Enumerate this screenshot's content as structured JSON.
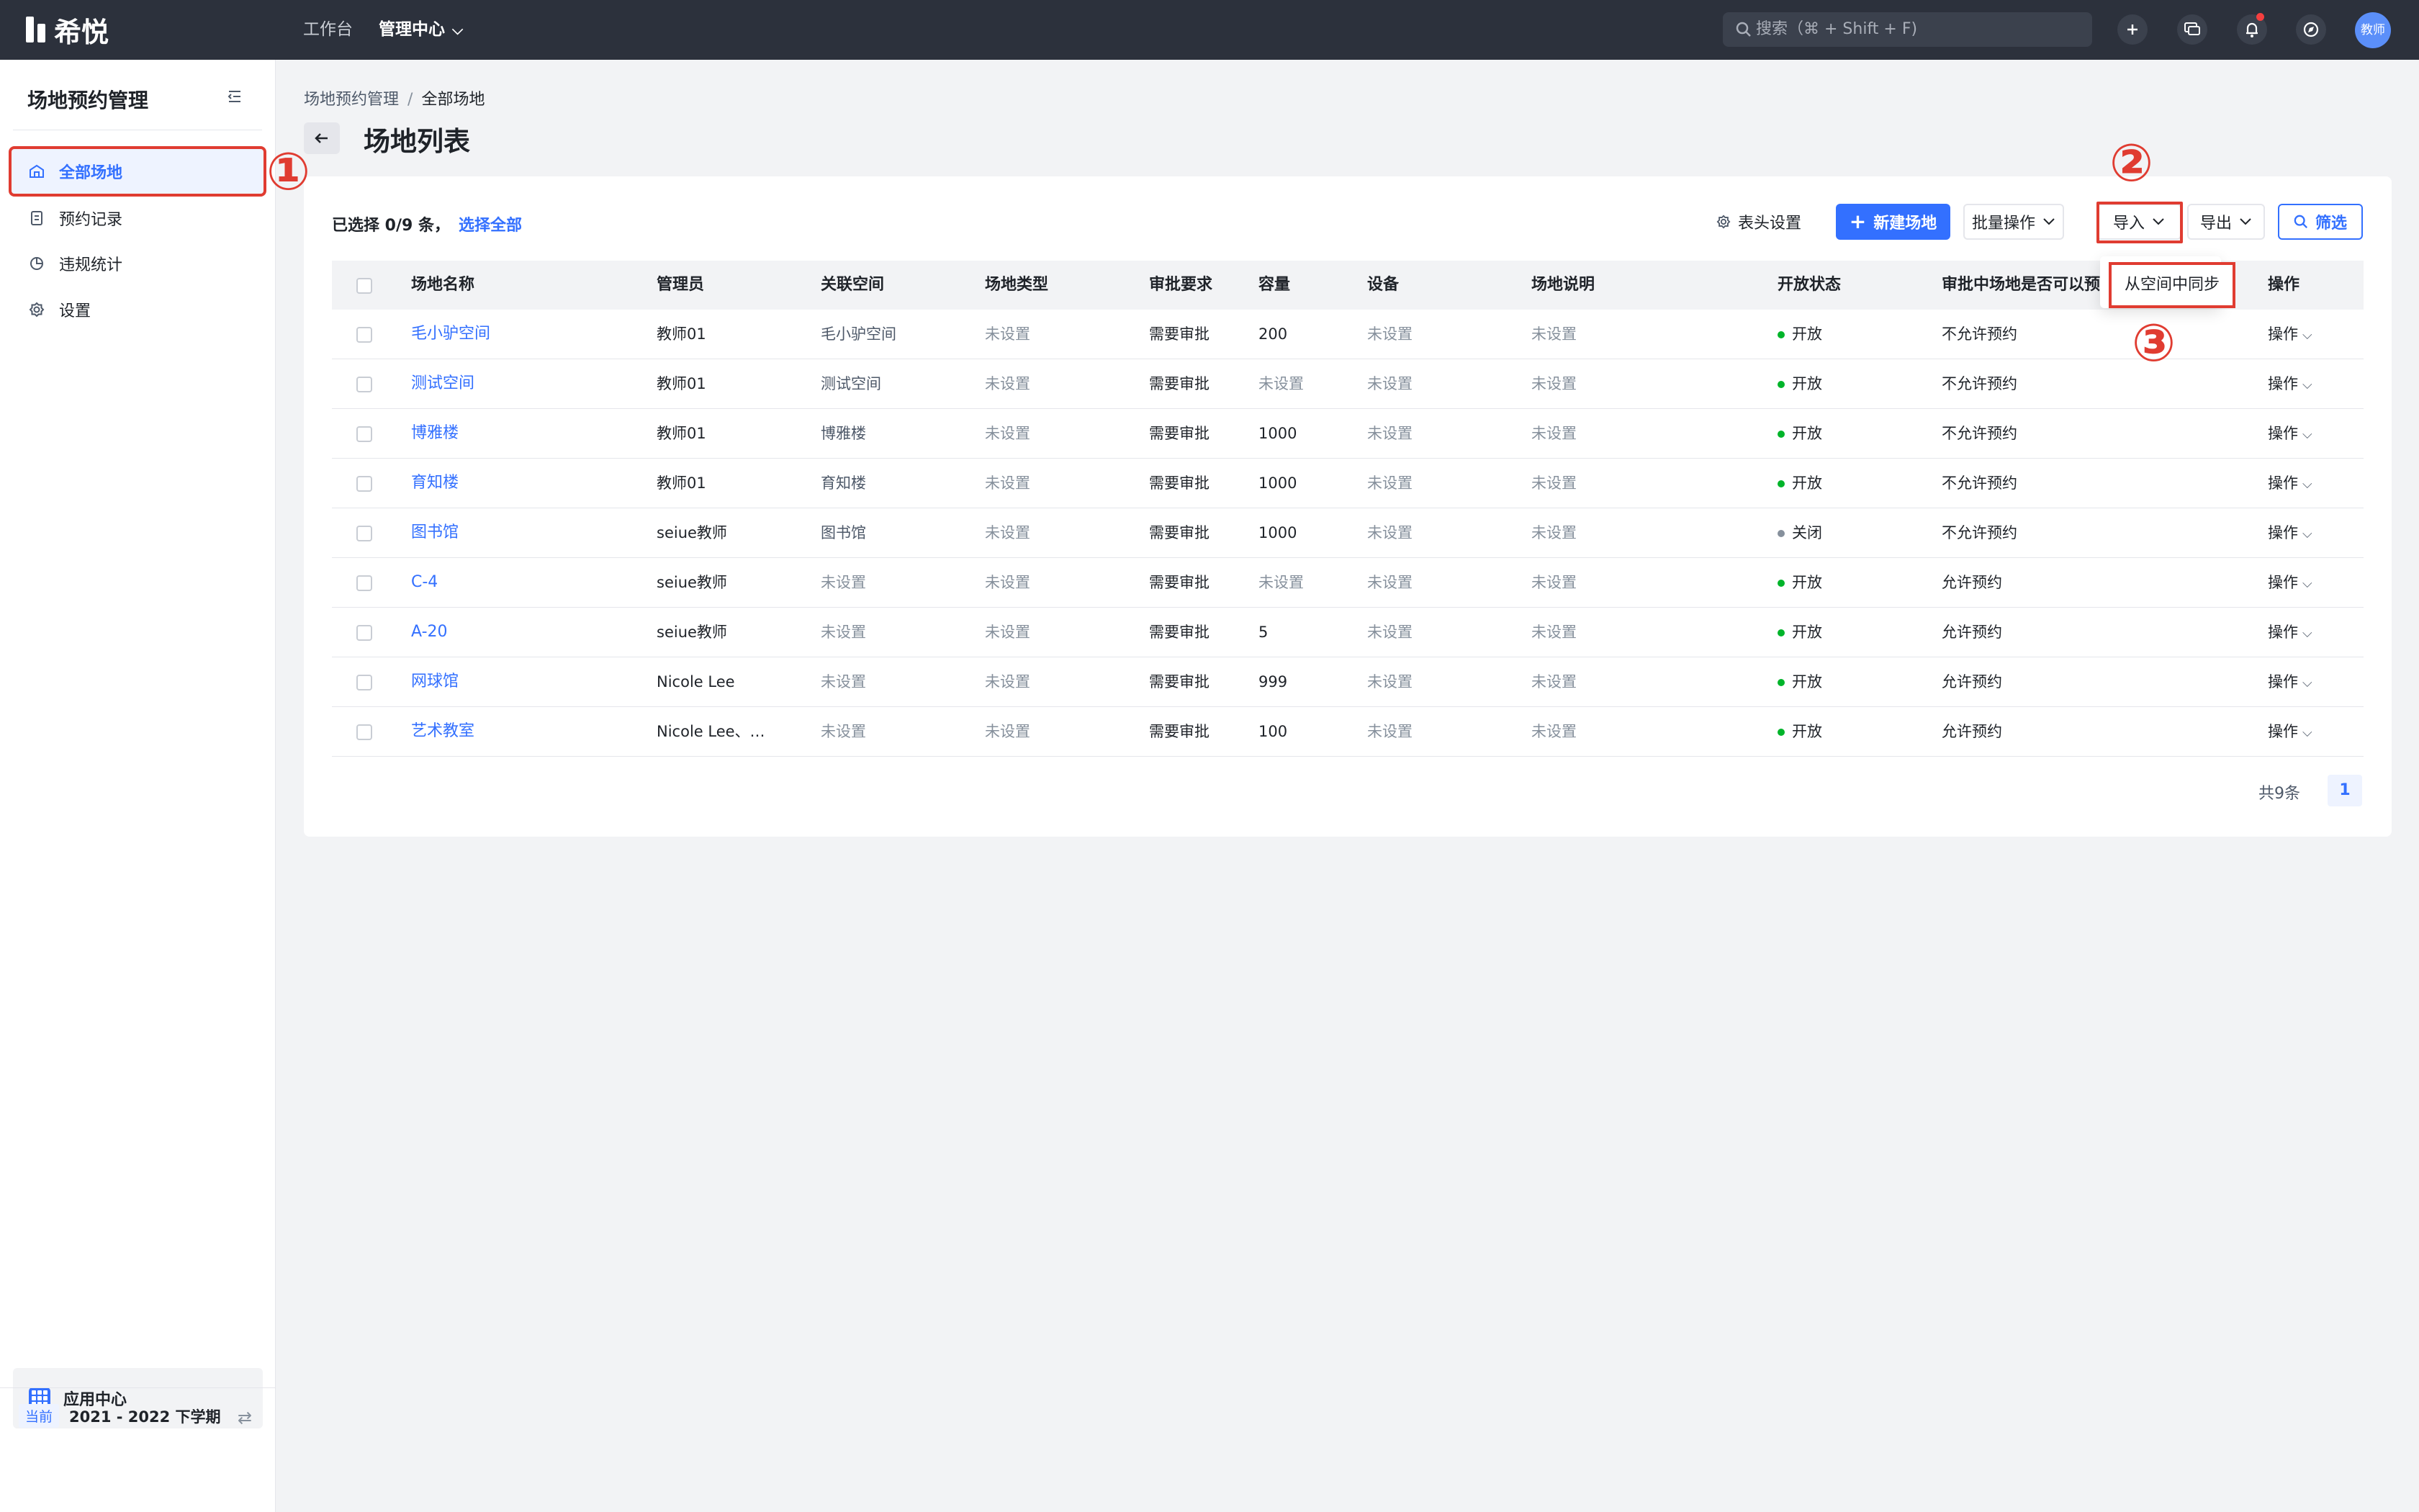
{
  "topbar": {
    "logo_text": "希悦",
    "nav": [
      {
        "label": "工作台"
      },
      {
        "label": "管理中心"
      }
    ],
    "search_placeholder": "搜索（⌘ + Shift + F)",
    "avatar_text": "教师"
  },
  "sidebar": {
    "title": "场地预约管理",
    "items": [
      {
        "label": "全部场地",
        "icon": "building-icon",
        "active": true
      },
      {
        "label": "预约记录",
        "icon": "document-icon",
        "active": false
      },
      {
        "label": "违规统计",
        "icon": "pie-chart-icon",
        "active": false
      },
      {
        "label": "设置",
        "icon": "gear-icon",
        "active": false
      }
    ],
    "app_center": "应用中心",
    "term_badge": "当前",
    "term": "2021 - 2022 下学期"
  },
  "main": {
    "breadcrumb": [
      "场地预约管理",
      "全部场地"
    ],
    "breadcrumb_sep": "/",
    "title": "场地列表",
    "selection_text": "已选择 0/9 条，",
    "select_all": "选择全部",
    "toolbar": {
      "column_settings": "表头设置",
      "new_venue": "新建场地",
      "batch": "批量操作",
      "import": "导入",
      "export": "导出",
      "filter": "筛选"
    },
    "import_menu": [
      "从空间中同步"
    ],
    "annotations": [
      "①",
      "②",
      "③"
    ],
    "columns": [
      "场地名称",
      "管理员",
      "关联空间",
      "场地类型",
      "审批要求",
      "容量",
      "设备",
      "场地说明",
      "开放状态",
      "审批中场地是否可以预约",
      "操作"
    ],
    "rows": [
      {
        "name": "毛小驴空间",
        "admin": "教师01",
        "space": "毛小驴空间",
        "type": "未设置",
        "approval": "需要审批",
        "capacity": "200",
        "equipment": "未设置",
        "desc": "未设置",
        "status": "开放",
        "pending": "不允许预约",
        "op": "操作"
      },
      {
        "name": "测试空间",
        "admin": "教师01",
        "space": "测试空间",
        "type": "未设置",
        "approval": "需要审批",
        "capacity": "未设置",
        "equipment": "未设置",
        "desc": "未设置",
        "status": "开放",
        "pending": "不允许预约",
        "op": "操作"
      },
      {
        "name": "博雅楼",
        "admin": "教师01",
        "space": "博雅楼",
        "type": "未设置",
        "approval": "需要审批",
        "capacity": "1000",
        "equipment": "未设置",
        "desc": "未设置",
        "status": "开放",
        "pending": "不允许预约",
        "op": "操作"
      },
      {
        "name": "育知楼",
        "admin": "教师01",
        "space": "育知楼",
        "type": "未设置",
        "approval": "需要审批",
        "capacity": "1000",
        "equipment": "未设置",
        "desc": "未设置",
        "status": "开放",
        "pending": "不允许预约",
        "op": "操作"
      },
      {
        "name": "图书馆",
        "admin": "seiue教师",
        "space": "图书馆",
        "type": "未设置",
        "approval": "需要审批",
        "capacity": "1000",
        "equipment": "未设置",
        "desc": "未设置",
        "status": "关闭",
        "pending": "不允许预约",
        "op": "操作"
      },
      {
        "name": "C-4",
        "admin": "seiue教师",
        "space": "未设置",
        "type": "未设置",
        "approval": "需要审批",
        "capacity": "未设置",
        "equipment": "未设置",
        "desc": "未设置",
        "status": "开放",
        "pending": "允许预约",
        "op": "操作"
      },
      {
        "name": "A-20",
        "admin": "seiue教师",
        "space": "未设置",
        "type": "未设置",
        "approval": "需要审批",
        "capacity": "5",
        "equipment": "未设置",
        "desc": "未设置",
        "status": "开放",
        "pending": "允许预约",
        "op": "操作"
      },
      {
        "name": "网球馆",
        "admin": "Nicole Lee",
        "space": "未设置",
        "type": "未设置",
        "approval": "需要审批",
        "capacity": "999",
        "equipment": "未设置",
        "desc": "未设置",
        "status": "开放",
        "pending": "允许预约",
        "op": "操作"
      },
      {
        "name": "艺术教室",
        "admin": "Nicole Lee、…",
        "space": "未设置",
        "type": "未设置",
        "approval": "需要审批",
        "capacity": "100",
        "equipment": "未设置",
        "desc": "未设置",
        "status": "开放",
        "pending": "允许预约",
        "op": "操作"
      }
    ],
    "pagination": {
      "total": "共9条",
      "page": "1"
    }
  },
  "colors": {
    "accent": "#3370ff",
    "open": "#00b42a",
    "closed": "#86909c",
    "annotation": "#e03c31"
  }
}
